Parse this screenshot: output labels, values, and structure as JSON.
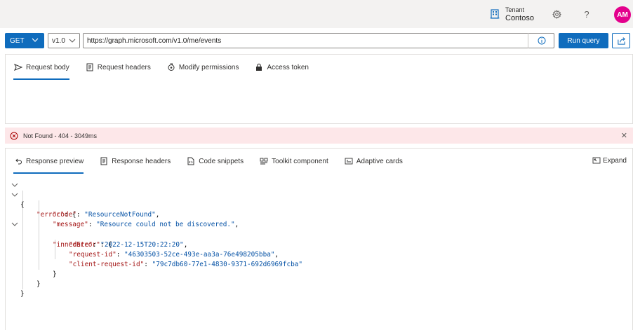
{
  "header": {
    "tenant_label": "Tenant",
    "tenant_name": "Contoso",
    "avatar_initials": "AM"
  },
  "query": {
    "method": "GET",
    "version": "v1.0",
    "url": "https://graph.microsoft.com/v1.0/me/events",
    "run_label": "Run query"
  },
  "request_tabs": [
    {
      "label": "Request body"
    },
    {
      "label": "Request headers"
    },
    {
      "label": "Modify permissions"
    },
    {
      "label": "Access token"
    }
  ],
  "status": {
    "message": "Not Found - 404 - 3049ms"
  },
  "response_tabs": [
    {
      "label": "Response preview"
    },
    {
      "label": "Response headers"
    },
    {
      "label": "Code snippets"
    },
    {
      "label": "Toolkit component"
    },
    {
      "label": "Adaptive cards"
    }
  ],
  "expand_label": "Expand",
  "response": {
    "error_key": "\"error\"",
    "code_key": "\"code\"",
    "code_value": "\"ResourceNotFound\"",
    "message_key": "\"message\"",
    "message_value": "\"Resource could not be discovered.\"",
    "inner_key": "\"innerError\"",
    "date_key": "\"date\"",
    "date_value": "\"2022-12-15T20:22:20\"",
    "request_id_key": "\"request-id\"",
    "request_id_value": "\"46303503-52ce-493e-aa3a-76e498205bba\"",
    "client_request_id_key": "\"client-request-id\"",
    "client_request_id_value": "\"79c7db60-77e1-4830-9371-692d6969fcba\""
  },
  "colors": {
    "accent": "#0f6cbd",
    "avatar": "#e3008c",
    "error_bg": "#fde7e9",
    "json_key": "#a31515",
    "json_string": "#0451a5"
  },
  "icons": {
    "tenant": "building-icon",
    "settings": "gear-icon",
    "help": "question-icon",
    "info": "info-icon",
    "share": "share-icon",
    "error": "error-circle-icon",
    "close": "close-icon",
    "expand": "expand-icon"
  }
}
